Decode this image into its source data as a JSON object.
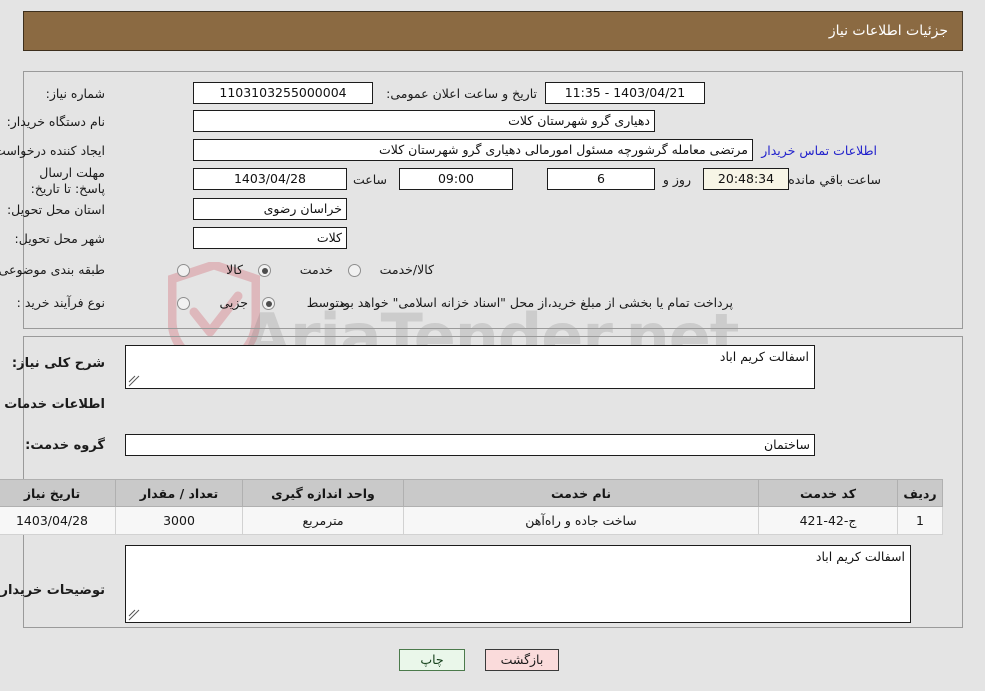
{
  "header": {
    "title": "جزئیات اطلاعات نیاز",
    "bg_color": "#8b6a42"
  },
  "watermark": {
    "text": "AriaTender.net"
  },
  "top_panel": {
    "need_number_label": "شماره نیاز:",
    "need_number_value": "1103103255000004",
    "public_announce_label": "تاریخ و ساعت اعلان عمومی:",
    "public_announce_value": "1403/04/21 - 11:35",
    "buyer_org_label": "نام دستگاه خریدار:",
    "buyer_org_value": "دهیاری گرو شهرستان کلات",
    "requester_label": "ایجاد کننده درخواست:",
    "requester_value": "مرتضی معامله گرشورچه مسئول امورمالی دهیاری گرو شهرستان کلات",
    "contact_link": "اطلاعات تماس خریدار",
    "deadline_label": "مهلت ارسال پاسخ: تا تاریخ:",
    "deadline_date": "1403/04/28",
    "time_label": "ساعت",
    "time_value": "09:00",
    "days_value": "6",
    "days_label": "روز و",
    "countdown_value": "20:48:34",
    "remaining_label": "ساعت باقي مانده",
    "province_label": "استان محل تحویل:",
    "province_value": "خراسان رضوی",
    "city_label": "شهر محل تحویل:",
    "city_value": "کلات",
    "category_label": "طبقه بندی موضوعی:",
    "category_options": [
      {
        "label": "کالا",
        "selected": false
      },
      {
        "label": "خدمت",
        "selected": true
      },
      {
        "label": "کالا/خدمت",
        "selected": false
      }
    ],
    "process_label": "نوع فرآیند خرید :",
    "process_options": [
      {
        "label": "جزیی",
        "selected": false
      },
      {
        "label": "متوسط",
        "selected": true
      }
    ],
    "payment_note": "پرداخت تمام یا بخشی از مبلغ خرید،از محل \"اسناد خزانه اسلامی\" خواهد بود."
  },
  "mid_panel": {
    "general_desc_label": "شرح کلی نیاز:",
    "general_desc_value": "اسفالت کریم اباد",
    "services_heading": "اطلاعات خدمات مورد نیاز",
    "service_group_label": "گروه خدمت:",
    "service_group_value": "ساختمان",
    "table": {
      "columns": [
        "ردیف",
        "کد خدمت",
        "نام خدمت",
        "واحد اندازه گیری",
        "تعداد / مقدار",
        "تاریخ نیاز"
      ],
      "rows": [
        {
          "row_no": "1",
          "service_code": "ج-42-421",
          "service_name": "ساخت جاده و راه‌آهن",
          "unit": "مترمربع",
          "quantity": "3000",
          "need_date": "1403/04/28"
        }
      ]
    },
    "buyer_notes_label": "توضیحات خریدار:",
    "buyer_notes_value": "اسفالت کریم اباد"
  },
  "footer": {
    "print_button": "چاپ",
    "back_button": "بازگشت"
  }
}
